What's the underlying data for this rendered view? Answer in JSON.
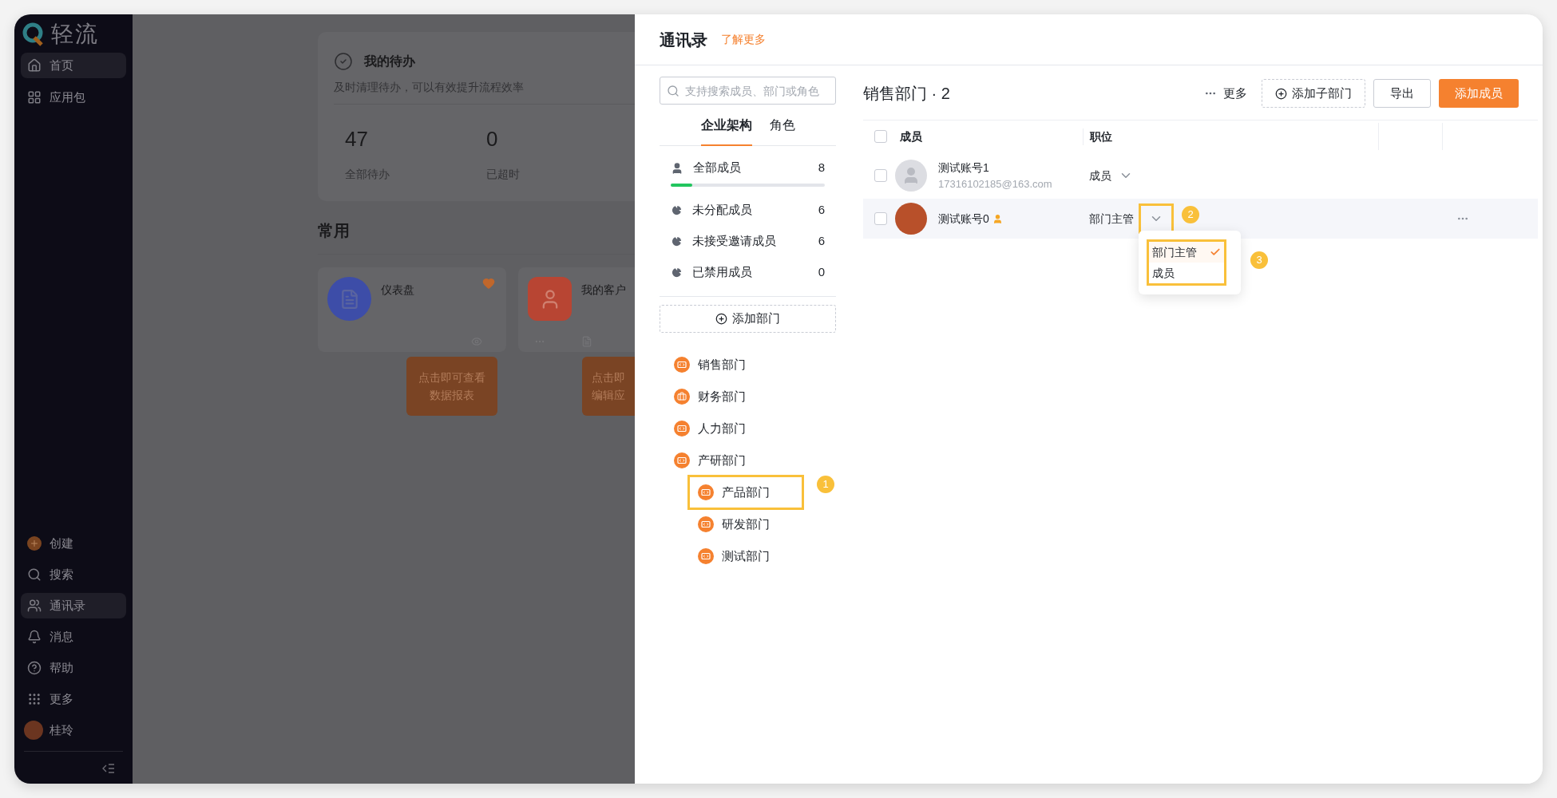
{
  "sidebar": {
    "logo": "轻流",
    "top_items": [
      {
        "label": "首页",
        "selected": true
      },
      {
        "label": "应用包",
        "selected": false
      }
    ],
    "bottom_items": [
      {
        "label": "创建",
        "selected": false
      },
      {
        "label": "搜索",
        "selected": false
      },
      {
        "label": "通讯录",
        "selected": true
      },
      {
        "label": "消息",
        "selected": false
      },
      {
        "label": "帮助",
        "selected": false
      },
      {
        "label": "更多",
        "selected": false
      }
    ],
    "user": {
      "name": "桂玲"
    }
  },
  "background": {
    "todo": {
      "title": "我的待办",
      "subtitle": "及时清理待办，可以有效提升流程效率",
      "stats": [
        {
          "value": "47",
          "label": "全部待办"
        },
        {
          "value": "0",
          "label": "已超时"
        }
      ]
    },
    "section_title": "常用",
    "apps": [
      {
        "name": "仪表盘",
        "kind": "dashboard",
        "color": "#3d4da8",
        "favorite": true,
        "tooltip": [
          "点击即可查看",
          "数据报表"
        ]
      },
      {
        "name": "我的客户",
        "kind": "customer",
        "color": "#b84533",
        "tooltip": [
          "点击即",
          "编辑应"
        ]
      }
    ]
  },
  "drawer": {
    "title": "通讯录",
    "learn_more": "了解更多",
    "search": {
      "placeholder": "支持搜索成员、部门或角色"
    },
    "tabs": [
      {
        "label": "企业架构",
        "selected": true
      },
      {
        "label": "角色",
        "selected": false
      }
    ],
    "member_groups": [
      {
        "label": "全部成员",
        "count": "8",
        "kind": "all",
        "level": 0.14
      },
      {
        "label": "未分配成员",
        "count": "6",
        "kind": "group"
      },
      {
        "label": "未接受邀请成员",
        "count": "6",
        "kind": "group"
      },
      {
        "label": "已禁用成员",
        "count": "0",
        "kind": "group"
      }
    ],
    "add_department": "添加部门",
    "departments": [
      {
        "label": "销售部门",
        "kind": "dept"
      },
      {
        "label": "财务部门",
        "kind": "finance"
      },
      {
        "label": "人力部门",
        "kind": "dept"
      },
      {
        "label": "产研部门",
        "kind": "dept",
        "children": [
          {
            "label": "产品部门",
            "kind": "dept",
            "annotation": "1"
          },
          {
            "label": "研发部门",
            "kind": "dept"
          },
          {
            "label": "测试部门",
            "kind": "dept"
          }
        ]
      }
    ]
  },
  "department_view": {
    "title": "销售部门 · 2",
    "more": "更多",
    "buttons": [
      {
        "label": "添加子部门",
        "kind": "dashed"
      },
      {
        "label": "导出",
        "kind": "outline"
      },
      {
        "label": "添加成员",
        "kind": "primary"
      }
    ],
    "select_all_checked": false,
    "columns": [
      "成员",
      "职位"
    ],
    "rows": [
      {
        "name": "测试账号1",
        "email": "17316102185@163.com",
        "kind": "placeholder",
        "admin": false,
        "checked": false,
        "position": "成员",
        "highlighted": false
      },
      {
        "name": "测试账号0",
        "kind": "photo",
        "admin": true,
        "checked": false,
        "position": "部门主管",
        "highlighted": true,
        "annotation": "2",
        "menu": {
          "annotation": "3",
          "options": [
            {
              "label": "部门主管",
              "selected": true
            },
            {
              "label": "成员",
              "selected": false
            }
          ]
        }
      }
    ]
  }
}
